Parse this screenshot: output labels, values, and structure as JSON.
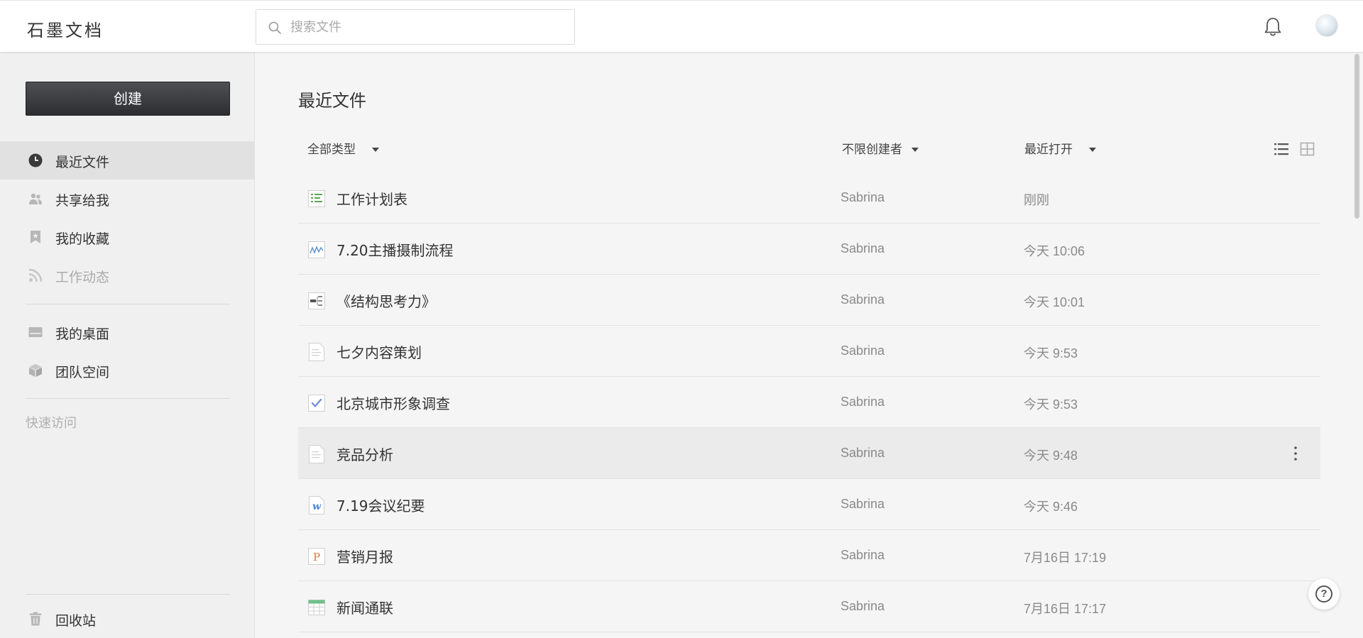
{
  "header": {
    "logo": "石墨文档",
    "search_placeholder": "搜索文件"
  },
  "sidebar": {
    "create_label": "创建",
    "nav": [
      {
        "label": "最近文件",
        "icon": "clock-icon",
        "active": true
      },
      {
        "label": "共享给我",
        "icon": "users-icon"
      },
      {
        "label": "我的收藏",
        "icon": "bookmark-icon"
      },
      {
        "label": "工作动态",
        "icon": "feed-icon",
        "disabled": true
      },
      {
        "label": "我的桌面",
        "icon": "desktop-icon"
      },
      {
        "label": "团队空间",
        "icon": "box-icon"
      }
    ],
    "quick_access": "快速访问",
    "trash": {
      "label": "回收站",
      "icon": "trash-icon"
    }
  },
  "main": {
    "title": "最近文件",
    "filters": {
      "type": "全部类型",
      "creator": "不限创建者",
      "sort": "最近打开"
    },
    "files": [
      {
        "name": "工作计划表",
        "owner": "Sabrina",
        "time": "刚刚",
        "icon": "outline-doc-icon"
      },
      {
        "name": "7.20主播摄制流程",
        "owner": "Sabrina",
        "time": "今天 10:06",
        "icon": "flowchart-icon"
      },
      {
        "name": "《结构思考力》",
        "owner": "Sabrina",
        "time": "今天 10:01",
        "icon": "mindmap-icon"
      },
      {
        "name": "七夕内容策划",
        "owner": "Sabrina",
        "time": "今天 9:53",
        "icon": "document-icon"
      },
      {
        "name": "北京城市形象调查",
        "owner": "Sabrina",
        "time": "今天 9:53",
        "icon": "form-icon"
      },
      {
        "name": "竞品分析",
        "owner": "Sabrina",
        "time": "今天 9:48",
        "icon": "document-icon"
      },
      {
        "name": "7.19会议纪要",
        "owner": "Sabrina",
        "time": "今天 9:46",
        "icon": "word-icon"
      },
      {
        "name": "营销月报",
        "owner": "Sabrina",
        "time": "7月16日 17:19",
        "icon": "ppt-icon"
      },
      {
        "name": "新闻通联",
        "owner": "Sabrina",
        "time": "7月16日 17:17",
        "icon": "spreadsheet-icon"
      }
    ]
  }
}
